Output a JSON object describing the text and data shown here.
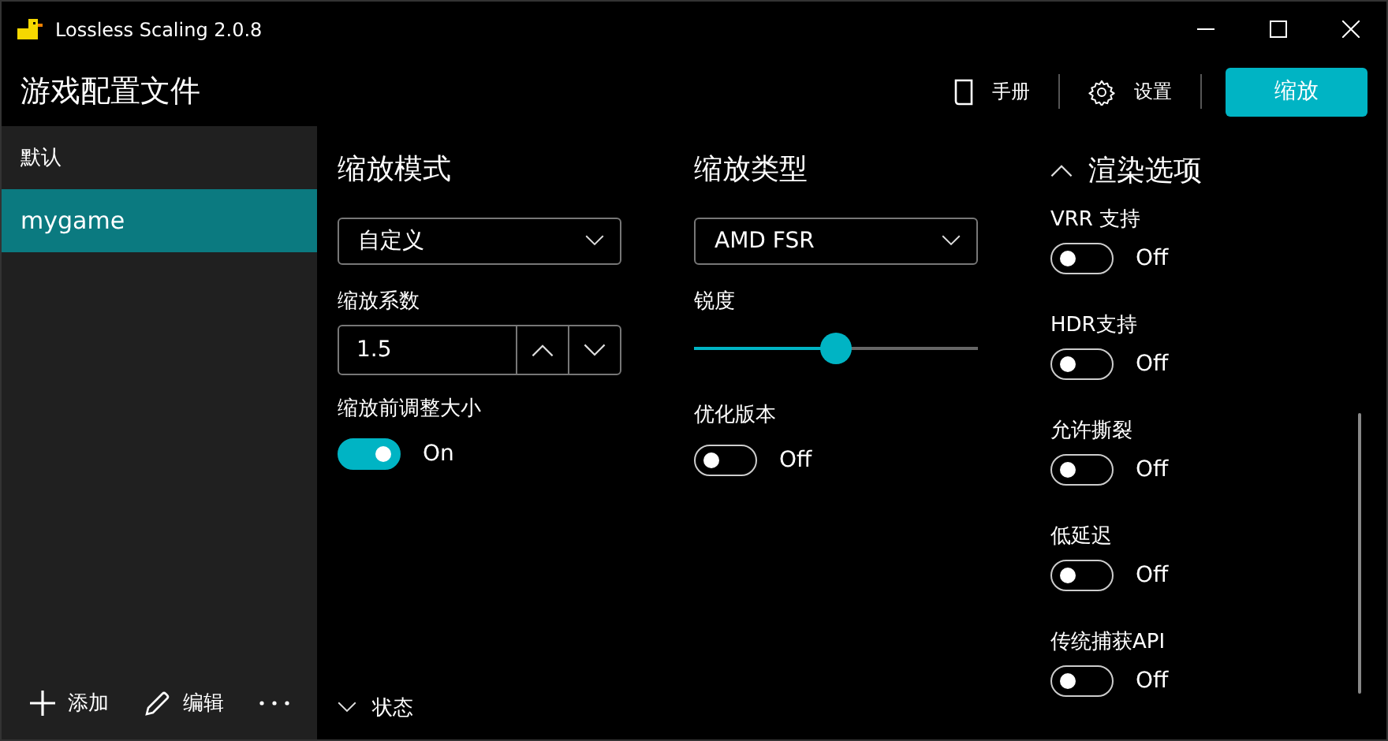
{
  "window": {
    "title": "Lossless Scaling 2.0.8"
  },
  "header": {
    "title": "游戏配置文件",
    "actions": [
      {
        "label": "手册",
        "kind": "manual"
      },
      {
        "label": "设置",
        "kind": "settings"
      }
    ],
    "primary_button": "缩放"
  },
  "sidebar": {
    "items": [
      {
        "label": "默认",
        "selected": false
      },
      {
        "label": "mygame",
        "selected": true
      }
    ],
    "footer": [
      {
        "label": "添加",
        "kind": "add"
      },
      {
        "label": "编辑",
        "kind": "edit"
      }
    ]
  },
  "scale_mode": {
    "title": "缩放模式",
    "mode": {
      "value": "自定义"
    },
    "factor": {
      "label": "缩放系数",
      "value": "1.5"
    },
    "resize": {
      "label": "缩放前调整大小",
      "on": true,
      "state_text": "On"
    }
  },
  "scale_type": {
    "title": "缩放类型",
    "type": {
      "value": "AMD FSR"
    },
    "sharpness": {
      "label": "锐度",
      "level": 0.5
    },
    "optimized": {
      "label": "优化版本",
      "on": false,
      "state_text": "Off"
    }
  },
  "render_options": {
    "title": "渲染选项",
    "expanded": true,
    "options": [
      {
        "label": "VRR 支持",
        "on": false,
        "state_text": "Off"
      },
      {
        "label": "HDR支持",
        "on": false,
        "state_text": "Off"
      },
      {
        "label": "允许撕裂",
        "on": false,
        "state_text": "Off"
      },
      {
        "label": "低延迟",
        "on": false,
        "state_text": "Off"
      },
      {
        "label": "传统捕获API",
        "on": false,
        "state_text": "Off"
      }
    ]
  },
  "status": {
    "label": "状态",
    "expanded": false
  }
}
